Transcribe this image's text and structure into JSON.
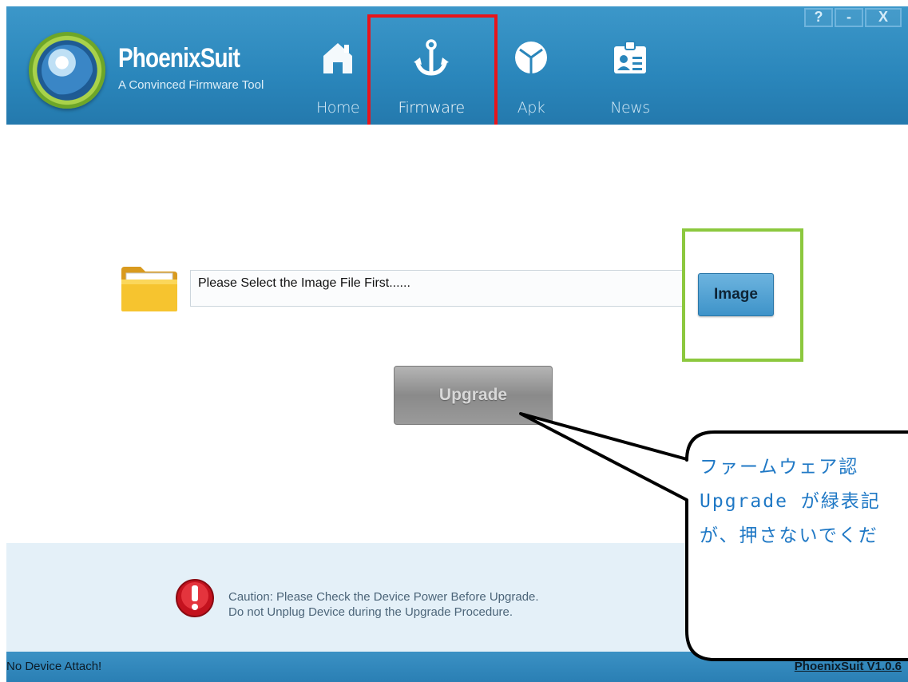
{
  "app": {
    "name": "PhoenixSuit",
    "tagline": "A Convinced Firmware Tool"
  },
  "window_controls": [
    "?",
    "-",
    "X"
  ],
  "nav": [
    {
      "label": "Home",
      "icon": "home-icon"
    },
    {
      "label": "Firmware",
      "icon": "anchor-icon"
    },
    {
      "label": "Apk",
      "icon": "cube-icon"
    },
    {
      "label": "News",
      "icon": "id-card-icon"
    }
  ],
  "firmware": {
    "path_placeholder": "Please Select the Image File First......",
    "image_button": "Image",
    "upgrade_button": "Upgrade"
  },
  "caution": {
    "line1": "Caution: Please Check the Device Power Before Upgrade.",
    "line2": "Do not Unplug Device during the Upgrade Procedure."
  },
  "status": {
    "left": "No Device Attach!",
    "right": "PhoenixSuit V1.0.6"
  },
  "callout": {
    "line1": "ファームウェア認",
    "line2": "Upgrade が緑表記",
    "line3": "が、押さないでくだ"
  },
  "colors": {
    "header": "#2a86bb",
    "highlight_red": "#e8141b",
    "highlight_green": "#8cc83e",
    "callout_text": "#1f78c5"
  }
}
